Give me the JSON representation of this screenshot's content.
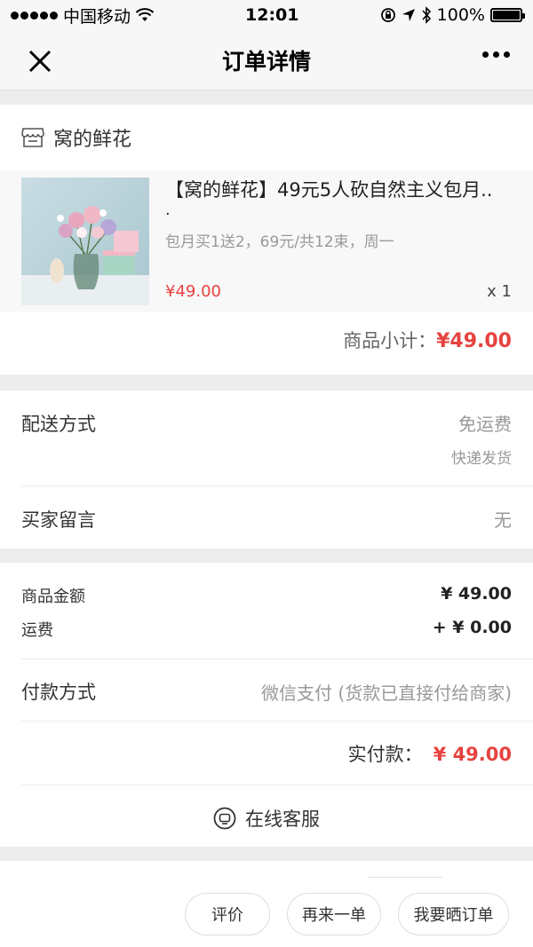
{
  "status_bar": {
    "carrier": "中国移动",
    "time": "12:01",
    "battery": "100%"
  },
  "nav": {
    "title": "订单详情"
  },
  "shop": {
    "name": "窝的鲜花",
    "product": {
      "title": "【窝的鲜花】49元5人砍自然主义包月..",
      "title_tail": ".",
      "sku": "包月买1送2，69元/共12束，周一",
      "price": "¥49.00",
      "qty": "x 1"
    },
    "subtotal_label": "商品小计：",
    "subtotal_value": "¥49.00"
  },
  "delivery": {
    "method_label": "配送方式",
    "method_value": "免运费",
    "method_sub": "快递发货",
    "note_label": "买家留言",
    "note_value": "无"
  },
  "summary": {
    "goods_label": "商品金额",
    "goods_value": "¥ 49.00",
    "freight_label": "运费",
    "freight_value": "+ ¥ 0.00",
    "pay_label": "付款方式",
    "pay_value": "微信支付 (货款已直接付给商家)",
    "paid_label": "实付款：",
    "paid_value": "¥ 49.00",
    "service_label": "在线客服"
  },
  "footer": {
    "review_label": "评价",
    "reorder_label": "再来一单",
    "share_label": "我要晒订单"
  },
  "colors": {
    "accent_red": "#e64340"
  }
}
